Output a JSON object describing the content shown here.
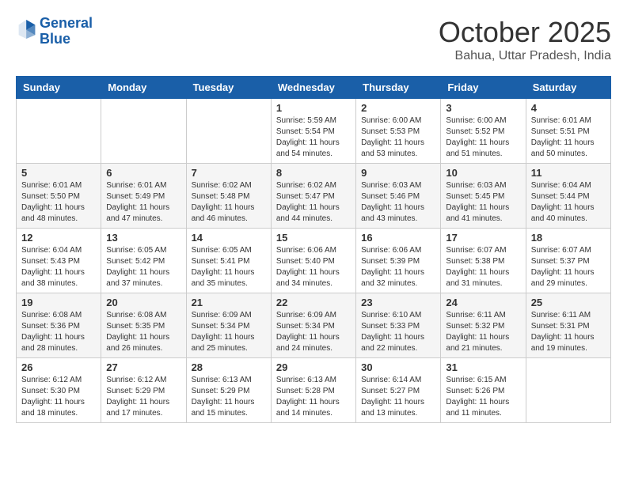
{
  "header": {
    "logo_line1": "General",
    "logo_line2": "Blue",
    "month": "October 2025",
    "location": "Bahua, Uttar Pradesh, India"
  },
  "weekdays": [
    "Sunday",
    "Monday",
    "Tuesday",
    "Wednesday",
    "Thursday",
    "Friday",
    "Saturday"
  ],
  "weeks": [
    [
      {
        "day": "",
        "info": ""
      },
      {
        "day": "",
        "info": ""
      },
      {
        "day": "",
        "info": ""
      },
      {
        "day": "1",
        "info": "Sunrise: 5:59 AM\nSunset: 5:54 PM\nDaylight: 11 hours\nand 54 minutes."
      },
      {
        "day": "2",
        "info": "Sunrise: 6:00 AM\nSunset: 5:53 PM\nDaylight: 11 hours\nand 53 minutes."
      },
      {
        "day": "3",
        "info": "Sunrise: 6:00 AM\nSunset: 5:52 PM\nDaylight: 11 hours\nand 51 minutes."
      },
      {
        "day": "4",
        "info": "Sunrise: 6:01 AM\nSunset: 5:51 PM\nDaylight: 11 hours\nand 50 minutes."
      }
    ],
    [
      {
        "day": "5",
        "info": "Sunrise: 6:01 AM\nSunset: 5:50 PM\nDaylight: 11 hours\nand 48 minutes."
      },
      {
        "day": "6",
        "info": "Sunrise: 6:01 AM\nSunset: 5:49 PM\nDaylight: 11 hours\nand 47 minutes."
      },
      {
        "day": "7",
        "info": "Sunrise: 6:02 AM\nSunset: 5:48 PM\nDaylight: 11 hours\nand 46 minutes."
      },
      {
        "day": "8",
        "info": "Sunrise: 6:02 AM\nSunset: 5:47 PM\nDaylight: 11 hours\nand 44 minutes."
      },
      {
        "day": "9",
        "info": "Sunrise: 6:03 AM\nSunset: 5:46 PM\nDaylight: 11 hours\nand 43 minutes."
      },
      {
        "day": "10",
        "info": "Sunrise: 6:03 AM\nSunset: 5:45 PM\nDaylight: 11 hours\nand 41 minutes."
      },
      {
        "day": "11",
        "info": "Sunrise: 6:04 AM\nSunset: 5:44 PM\nDaylight: 11 hours\nand 40 minutes."
      }
    ],
    [
      {
        "day": "12",
        "info": "Sunrise: 6:04 AM\nSunset: 5:43 PM\nDaylight: 11 hours\nand 38 minutes."
      },
      {
        "day": "13",
        "info": "Sunrise: 6:05 AM\nSunset: 5:42 PM\nDaylight: 11 hours\nand 37 minutes."
      },
      {
        "day": "14",
        "info": "Sunrise: 6:05 AM\nSunset: 5:41 PM\nDaylight: 11 hours\nand 35 minutes."
      },
      {
        "day": "15",
        "info": "Sunrise: 6:06 AM\nSunset: 5:40 PM\nDaylight: 11 hours\nand 34 minutes."
      },
      {
        "day": "16",
        "info": "Sunrise: 6:06 AM\nSunset: 5:39 PM\nDaylight: 11 hours\nand 32 minutes."
      },
      {
        "day": "17",
        "info": "Sunrise: 6:07 AM\nSunset: 5:38 PM\nDaylight: 11 hours\nand 31 minutes."
      },
      {
        "day": "18",
        "info": "Sunrise: 6:07 AM\nSunset: 5:37 PM\nDaylight: 11 hours\nand 29 minutes."
      }
    ],
    [
      {
        "day": "19",
        "info": "Sunrise: 6:08 AM\nSunset: 5:36 PM\nDaylight: 11 hours\nand 28 minutes."
      },
      {
        "day": "20",
        "info": "Sunrise: 6:08 AM\nSunset: 5:35 PM\nDaylight: 11 hours\nand 26 minutes."
      },
      {
        "day": "21",
        "info": "Sunrise: 6:09 AM\nSunset: 5:34 PM\nDaylight: 11 hours\nand 25 minutes."
      },
      {
        "day": "22",
        "info": "Sunrise: 6:09 AM\nSunset: 5:34 PM\nDaylight: 11 hours\nand 24 minutes."
      },
      {
        "day": "23",
        "info": "Sunrise: 6:10 AM\nSunset: 5:33 PM\nDaylight: 11 hours\nand 22 minutes."
      },
      {
        "day": "24",
        "info": "Sunrise: 6:11 AM\nSunset: 5:32 PM\nDaylight: 11 hours\nand 21 minutes."
      },
      {
        "day": "25",
        "info": "Sunrise: 6:11 AM\nSunset: 5:31 PM\nDaylight: 11 hours\nand 19 minutes."
      }
    ],
    [
      {
        "day": "26",
        "info": "Sunrise: 6:12 AM\nSunset: 5:30 PM\nDaylight: 11 hours\nand 18 minutes."
      },
      {
        "day": "27",
        "info": "Sunrise: 6:12 AM\nSunset: 5:29 PM\nDaylight: 11 hours\nand 17 minutes."
      },
      {
        "day": "28",
        "info": "Sunrise: 6:13 AM\nSunset: 5:29 PM\nDaylight: 11 hours\nand 15 minutes."
      },
      {
        "day": "29",
        "info": "Sunrise: 6:13 AM\nSunset: 5:28 PM\nDaylight: 11 hours\nand 14 minutes."
      },
      {
        "day": "30",
        "info": "Sunrise: 6:14 AM\nSunset: 5:27 PM\nDaylight: 11 hours\nand 13 minutes."
      },
      {
        "day": "31",
        "info": "Sunrise: 6:15 AM\nSunset: 5:26 PM\nDaylight: 11 hours\nand 11 minutes."
      },
      {
        "day": "",
        "info": ""
      }
    ]
  ]
}
